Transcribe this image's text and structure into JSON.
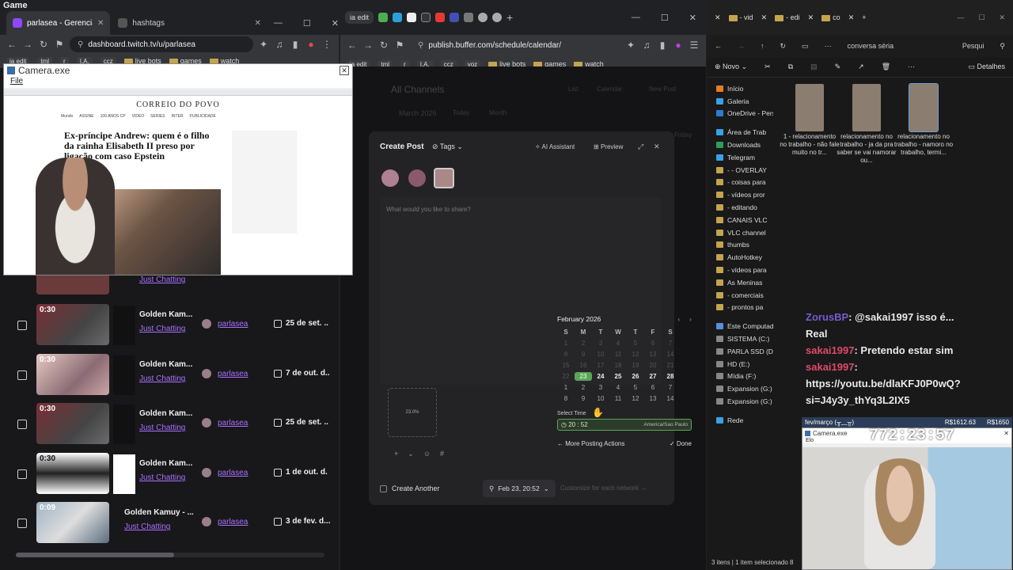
{
  "top_title": "Game",
  "left_browser": {
    "tabs": [
      {
        "label": "parlasea - Gerenciador de c",
        "active": true
      },
      {
        "label": "hashtags",
        "active": false
      }
    ],
    "url": "dashboard.twitch.tv/u/parlasea",
    "bookmarks": [
      "ia edit",
      "tml",
      "r",
      "I.A.",
      "ccz",
      "live bots",
      "games",
      "watch"
    ],
    "videos": [
      {
        "duration": "",
        "title": "",
        "category": "Just Chatting",
        "user": "",
        "date": ""
      },
      {
        "duration": "0:30",
        "title": "Golden Kam...",
        "category": "Just Chatting",
        "user": "parlasea",
        "date": "25 de set. .."
      },
      {
        "duration": "0:30",
        "title": "Golden Kam...",
        "category": "Just Chatting",
        "user": "parlasea",
        "date": "7 de out. d.."
      },
      {
        "duration": "0:30",
        "title": "Golden Kam...",
        "category": "Just Chatting",
        "user": "parlasea",
        "date": "25 de set. .."
      },
      {
        "duration": "0:30",
        "title": "Golden Kam...",
        "category": "Just Chatting",
        "user": "parlasea",
        "date": "1 de out. d."
      },
      {
        "duration": "0:09",
        "title": "Golden Kamuy - ...",
        "category": "Just Chatting",
        "user": "parlasea",
        "date": "3 de fev. d..."
      }
    ]
  },
  "camera_overlay": {
    "title": "Camera.exe",
    "menu": "File",
    "news_site": "CORREIO DO POVO",
    "news_nav": [
      "Mundo",
      "ASSINE",
      "100 ANOS CP",
      "VIDEO",
      "SERIES",
      "INTER",
      "PUBLICIDADE"
    ],
    "headline": "Ex-príncipe Andrew: quem é o filho da rainha Elisabeth II preso por ligação com caso Epstein"
  },
  "middle_browser": {
    "url": "publish.buffer.com/schedule/calendar/",
    "bookmarks": [
      "ia edit",
      "tml",
      "r",
      "I.A.",
      "ccz",
      "voz",
      "live bots",
      "games",
      "watch"
    ],
    "background": {
      "channels": "All Channels",
      "view_list": "List",
      "view_calendar": "Calendar",
      "new_post": "New Post",
      "month_label": "March 2026",
      "today": "Today",
      "month_sel": "Month",
      "friday": "Friday"
    },
    "create_post": {
      "title": "Create Post",
      "tags": "Tags",
      "ai": "AI Assistant",
      "preview": "Preview",
      "placeholder": "What would you like to share?",
      "upload_progress": "23.0%",
      "create_another": "Create Another",
      "schedule_chip": "Feb 23, 20:52",
      "customize": "Customize for each network"
    },
    "calendar": {
      "month": "February 2026",
      "weekdays": [
        "S",
        "M",
        "T",
        "W",
        "T",
        "F",
        "S"
      ],
      "days": [
        "1",
        "2",
        "3",
        "4",
        "5",
        "6",
        "7",
        "8",
        "9",
        "10",
        "11",
        "12",
        "13",
        "14",
        "15",
        "16",
        "17",
        "18",
        "19",
        "20",
        "21",
        "22",
        "23",
        "24",
        "25",
        "26",
        "27",
        "28",
        "1",
        "2",
        "3",
        "4",
        "5",
        "6",
        "7",
        "8",
        "9",
        "10",
        "11",
        "12",
        "13",
        "14"
      ],
      "select_time": "Select Time",
      "time": "20 : 52",
      "timezone": "America/Sao Paulo",
      "more_actions": "More Posting Actions",
      "done": "Done"
    }
  },
  "file_explorer": {
    "tabs": [
      "- vid",
      "- edi",
      "co"
    ],
    "path": "conversa séria",
    "search": "Pesqui",
    "new_label": "Novo",
    "details": "Detalhes",
    "sidebar": [
      "Início",
      "Galeria",
      "OneDrive - Pers",
      "Área de Trab",
      "Downloads",
      "Telegram",
      "- - OVERLAY",
      "- coisas para",
      "- vídeos pror",
      "- editando",
      "CANAIS VLC",
      "VLC channel",
      "thumbs",
      "AutoHotkey",
      "- vídeos para",
      "As Meninas",
      "- comerciais",
      "- prontos pa",
      "Este Computad",
      "SISTEMA (C:)",
      "PARLA SSD (D",
      "HD (E:)",
      "Mídia (F:)",
      "Expansion (G:)",
      "Expansion (G:)",
      "Rede"
    ],
    "files": [
      {
        "name": "1 - relacionamento no trabalho - não fale muito no tr..."
      },
      {
        "name": "relacionamento no trabalho - ja da pra saber se vai namorar ou..."
      },
      {
        "name": "relacionamento no trabalho - namoro no trabalho, termi..."
      }
    ],
    "status": "3 itens  |  1 item selecionado 8"
  },
  "chat": [
    {
      "user": "ZorusBP",
      "text": ": @sakai1997 isso é..."
    },
    {
      "user": "",
      "text": "Real"
    },
    {
      "user": "sakai1997",
      "text": ": Pretendo estar sim"
    },
    {
      "user": "sakai1997",
      "text": ":"
    },
    {
      "user": "",
      "text": "https://youtu.be/dlaKFJ0P0wQ?"
    },
    {
      "user": "",
      "text": "si=J4y3y_thYq3L2IX5"
    }
  ],
  "goal_bar": {
    "label": "fev/março (╥﹏╥)",
    "amount": "R$1612.63",
    "target": "R$1650"
  },
  "camera2": {
    "title": "Camera.exe",
    "menu": "Elo",
    "timer": "772:23:57"
  },
  "colors": {
    "twitch_purple": "#a970ff",
    "buffer_green": "#5aa657",
    "dark_bg": "#18181b"
  }
}
